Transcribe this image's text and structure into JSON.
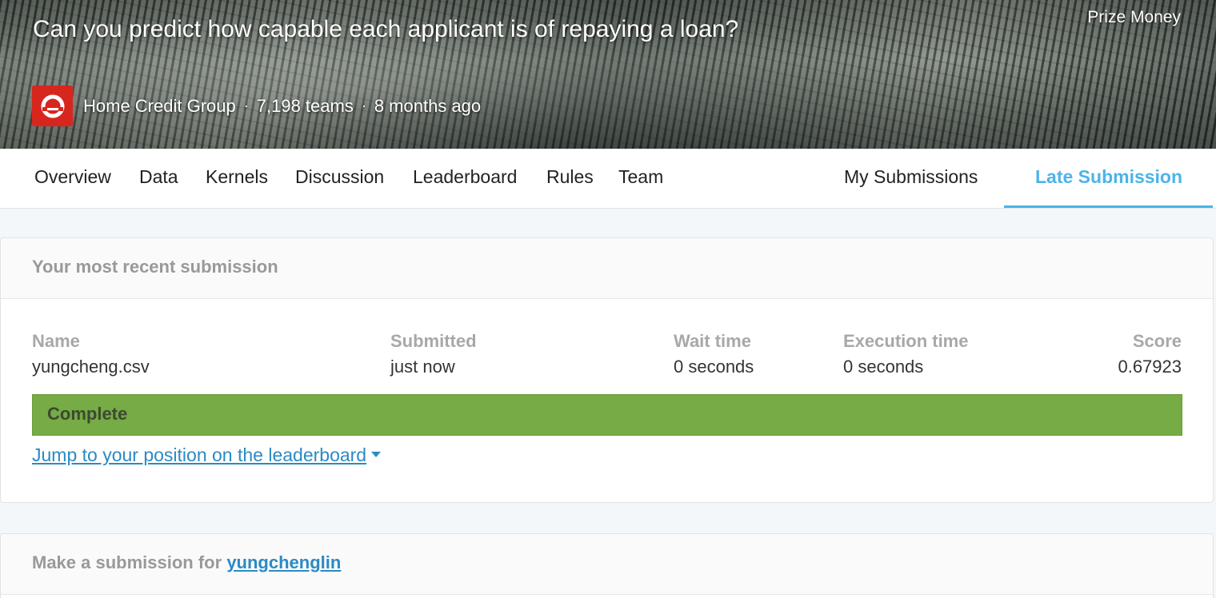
{
  "banner": {
    "title": "Can you predict how capable each applicant is of repaying a loan?",
    "prize_label": "Prize Money",
    "host": "Home Credit Group",
    "teams": "7,198 teams",
    "time_ago": "8 months ago",
    "separator": "·",
    "logo_color": "#d7261e"
  },
  "tabs": [
    {
      "label": "Overview"
    },
    {
      "label": "Data"
    },
    {
      "label": "Kernels"
    },
    {
      "label": "Discussion"
    },
    {
      "label": "Leaderboard"
    },
    {
      "label": "Rules"
    },
    {
      "label": "Team"
    },
    {
      "label": "My Submissions"
    },
    {
      "label": "Late Submission",
      "active": true
    }
  ],
  "recent": {
    "heading": "Your most recent submission",
    "columns": {
      "name": {
        "label": "Name",
        "value": "yungcheng.csv"
      },
      "submitted": {
        "label": "Submitted",
        "value": "just now"
      },
      "wait": {
        "label": "Wait time",
        "value": "0 seconds"
      },
      "execution": {
        "label": "Execution time",
        "value": "0 seconds"
      },
      "score": {
        "label": "Score",
        "value": "0.67923"
      }
    },
    "status": "Complete",
    "status_color": "#76ab45",
    "jump_link": "Jump to your position on the leaderboard"
  },
  "make_submission": {
    "prefix": "Make a submission for",
    "user": "yungchenglin"
  },
  "colors": {
    "accent": "#4cb3e9",
    "link": "#2b8ac4"
  }
}
